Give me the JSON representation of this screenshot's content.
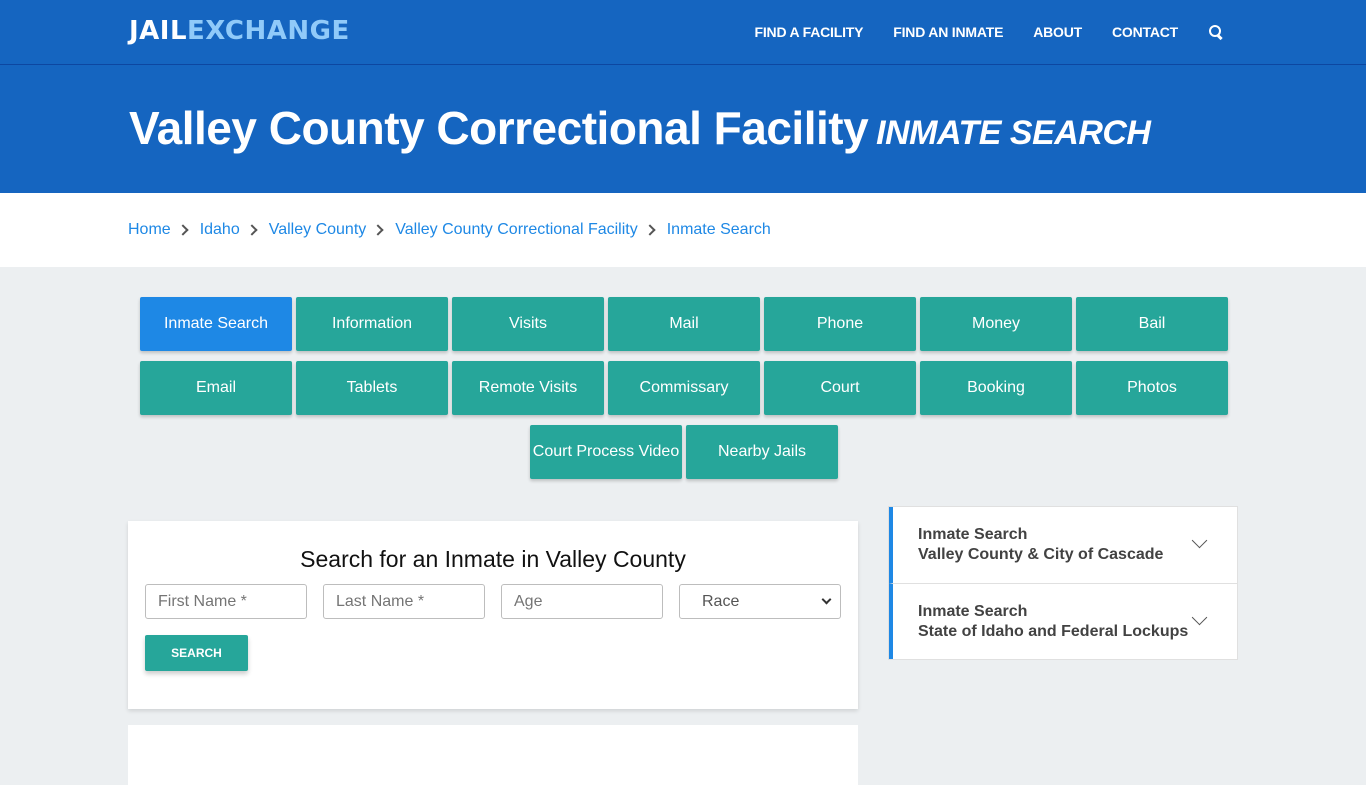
{
  "brand": {
    "part1": "JAIL",
    "part2": "EXCHANGE"
  },
  "nav": {
    "items": [
      "FIND A FACILITY",
      "FIND AN INMATE",
      "ABOUT",
      "CONTACT"
    ],
    "search_icon": "search-icon"
  },
  "hero": {
    "title": "Valley County Correctional Facility",
    "subtitle": "INMATE SEARCH"
  },
  "breadcrumb": [
    "Home",
    "Idaho",
    "Valley County",
    "Valley County Correctional Facility",
    "Inmate Search"
  ],
  "tabs": {
    "row1": [
      "Inmate Search",
      "Information",
      "Visits",
      "Mail",
      "Phone",
      "Money",
      "Bail"
    ],
    "row2": [
      "Email",
      "Tablets",
      "Remote Visits",
      "Commissary",
      "Court",
      "Booking",
      "Photos"
    ],
    "row3": [
      "Court Process Video",
      "Nearby Jails"
    ],
    "active": "Inmate Search"
  },
  "search": {
    "heading": "Search for an Inmate in Valley County",
    "first_name_placeholder": "First Name *",
    "last_name_placeholder": "Last Name *",
    "age_placeholder": "Age",
    "race_selected": "Race",
    "button": "SEARCH"
  },
  "sidebar": {
    "items": [
      {
        "line1": "Inmate Search",
        "line2": "Valley County & City of Cascade"
      },
      {
        "line1": "Inmate Search",
        "line2": "State of Idaho and Federal Lockups"
      }
    ]
  },
  "colors": {
    "primary": "#1565c0",
    "accent": "#1e88e5",
    "teal": "#26a69a"
  }
}
